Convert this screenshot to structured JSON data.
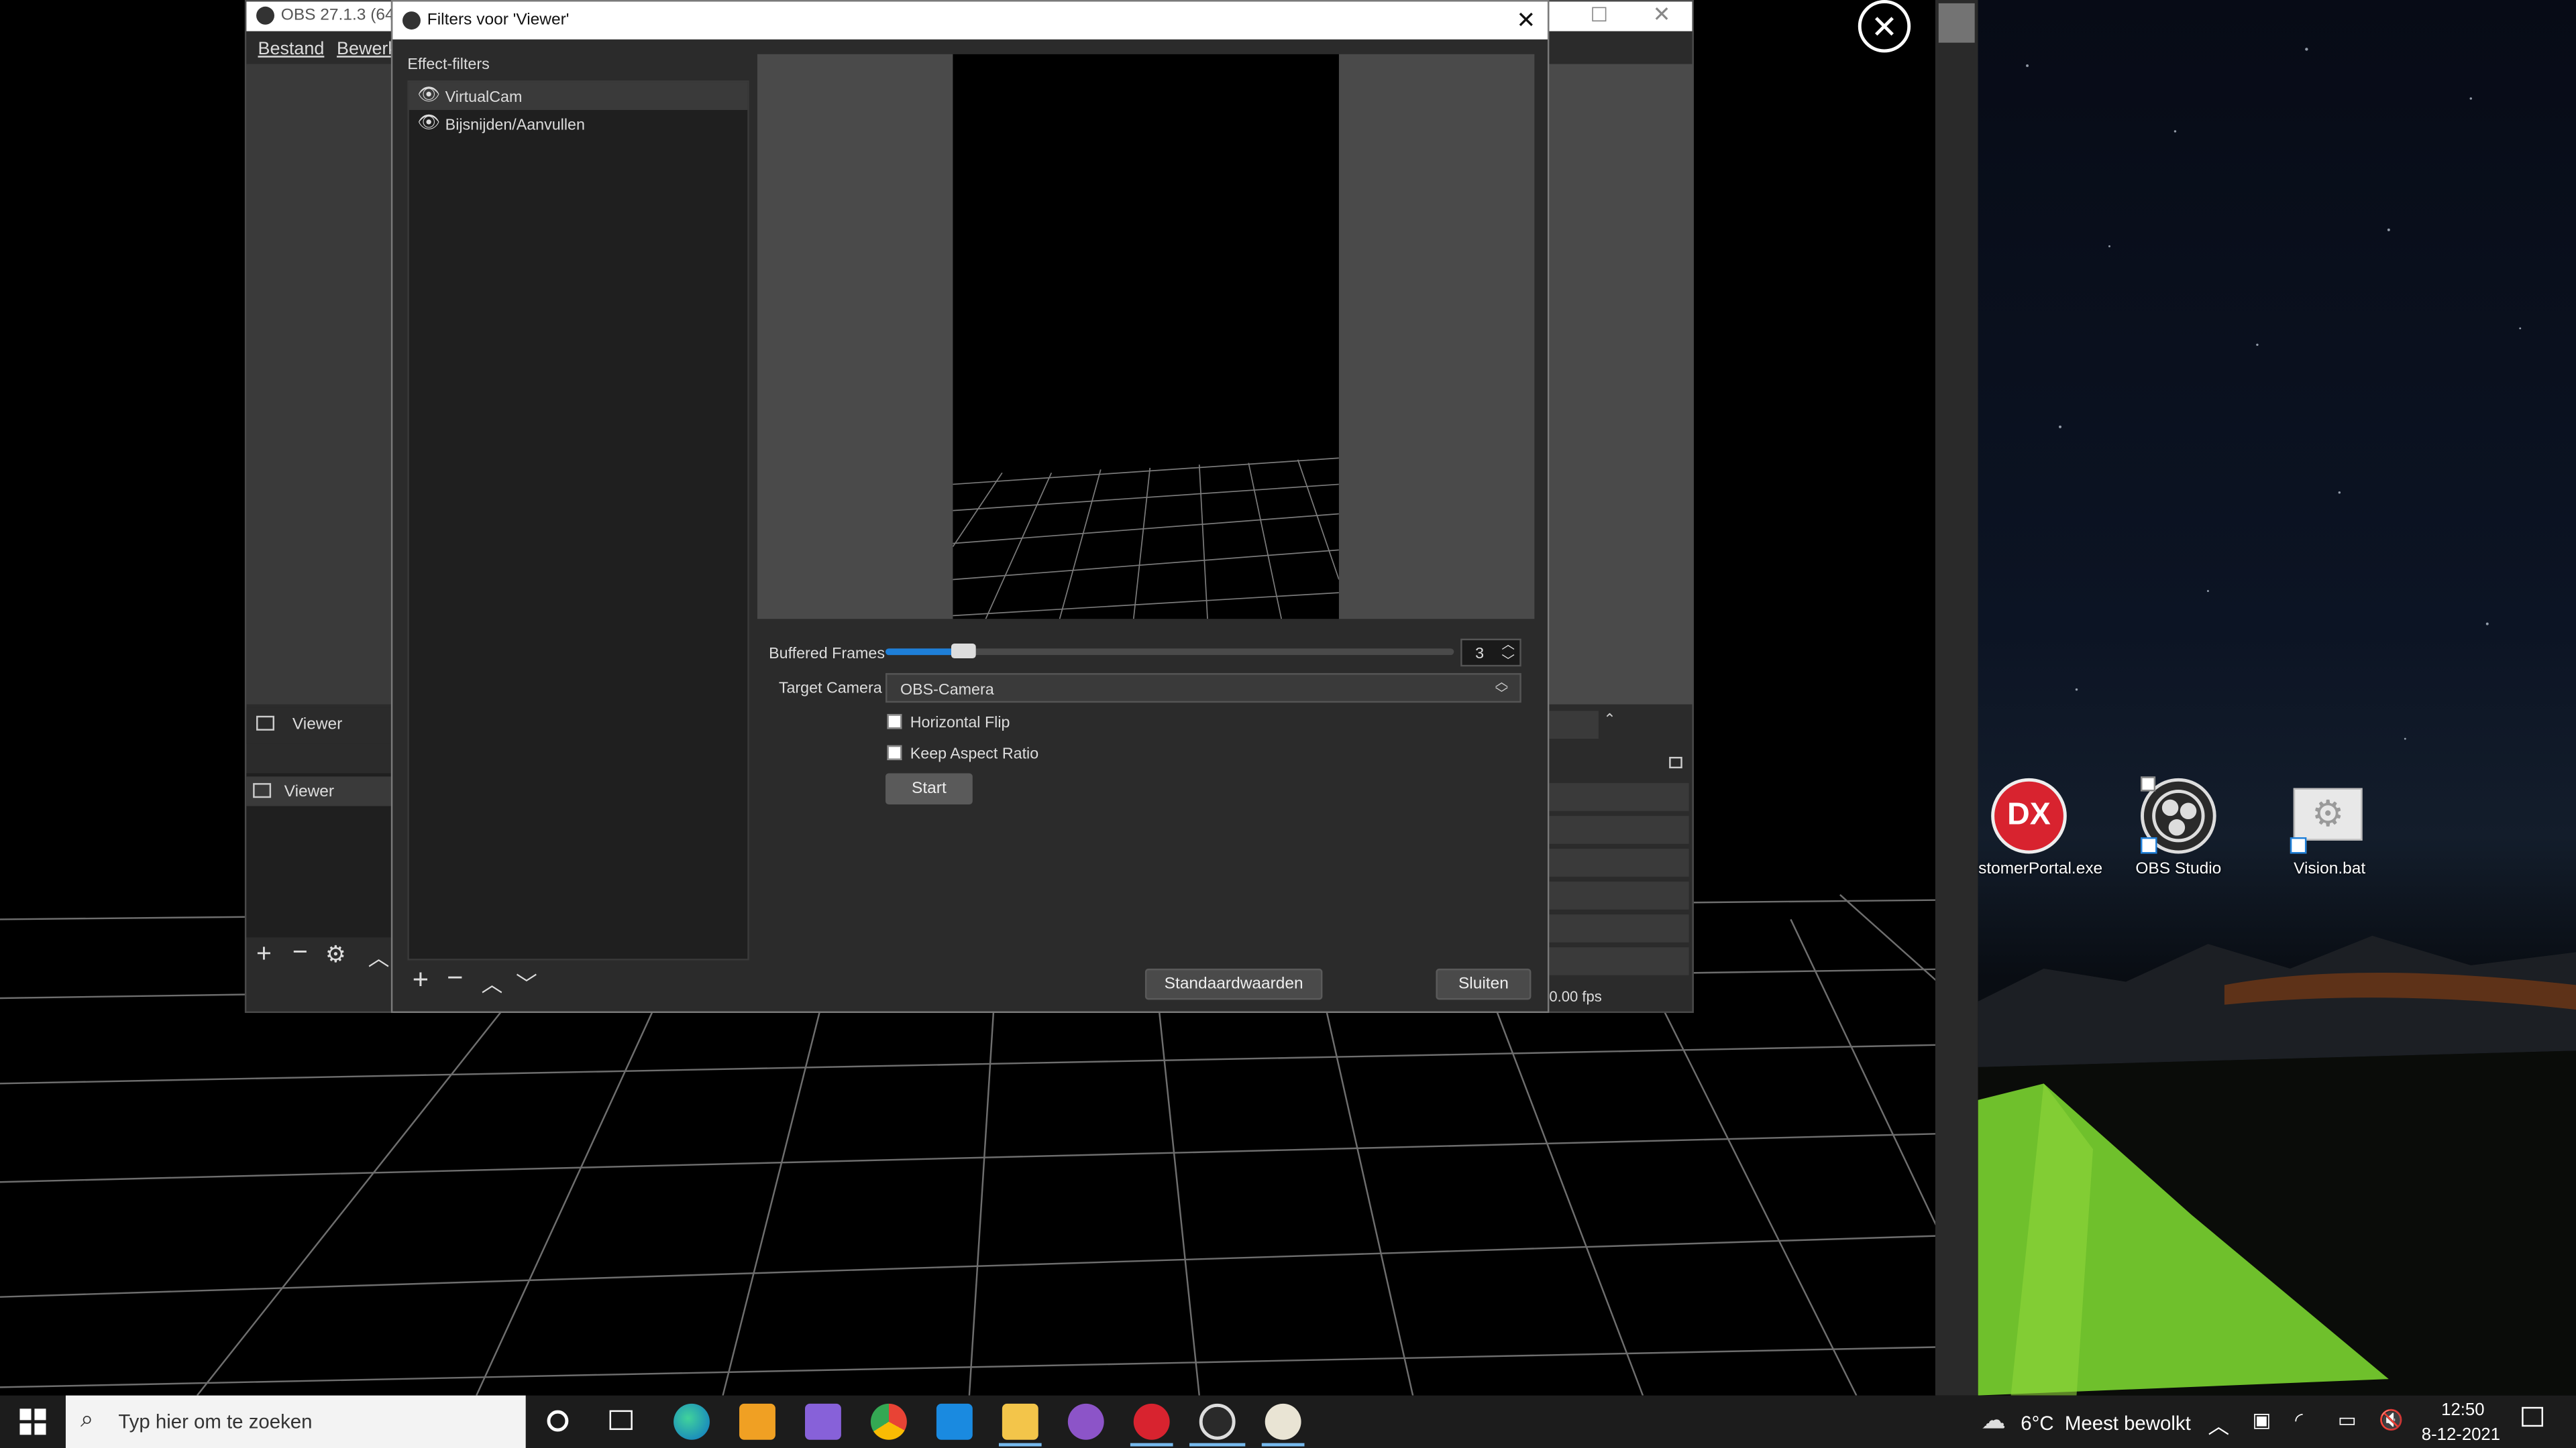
{
  "obs_window": {
    "title": "OBS 27.1.3 (64-",
    "menu": [
      "Bestand",
      "Bewerk"
    ],
    "scene_label": "Viewer",
    "source_label": "Viewer",
    "fps": "0.00 fps"
  },
  "filters_dialog": {
    "title": "Filters voor 'Viewer'",
    "section_label": "Effect-filters",
    "filters": [
      {
        "name": "VirtualCam",
        "visible": true,
        "selected": true
      },
      {
        "name": "Bijsnijden/Aanvullen",
        "visible": true,
        "selected": false
      }
    ],
    "buffered_frames_label": "Buffered Frames",
    "buffered_frames_value": "3",
    "buffered_frames_fraction": 0.12,
    "target_camera_label": "Target Camera",
    "target_camera_value": "OBS-Camera",
    "horizontal_flip_label": "Horizontal Flip",
    "keep_aspect_label": "Keep Aspect Ratio",
    "start_label": "Start",
    "defaults_label": "Standaardwaarden",
    "close_label": "Sluiten"
  },
  "desktop_icons": [
    {
      "label": "stomerPortal.exe",
      "icon": "dx-icon",
      "color": "#d8232f"
    },
    {
      "label": "OBS Studio",
      "icon": "obs-icon",
      "color": "#2a2a2a"
    },
    {
      "label": "Vision.bat",
      "icon": "gear-file-icon",
      "color": "#e8e8e8"
    }
  ],
  "taskbar": {
    "search_placeholder": "Typ hier om te zoeken",
    "weather": "6°C  Meest bewolkt",
    "time": "12:50",
    "date": "8-12-2021"
  },
  "colors": {
    "accent": "#1e7fd8",
    "dialog_bg": "#2b2b2b",
    "panel_bg": "#1f1f1f"
  }
}
